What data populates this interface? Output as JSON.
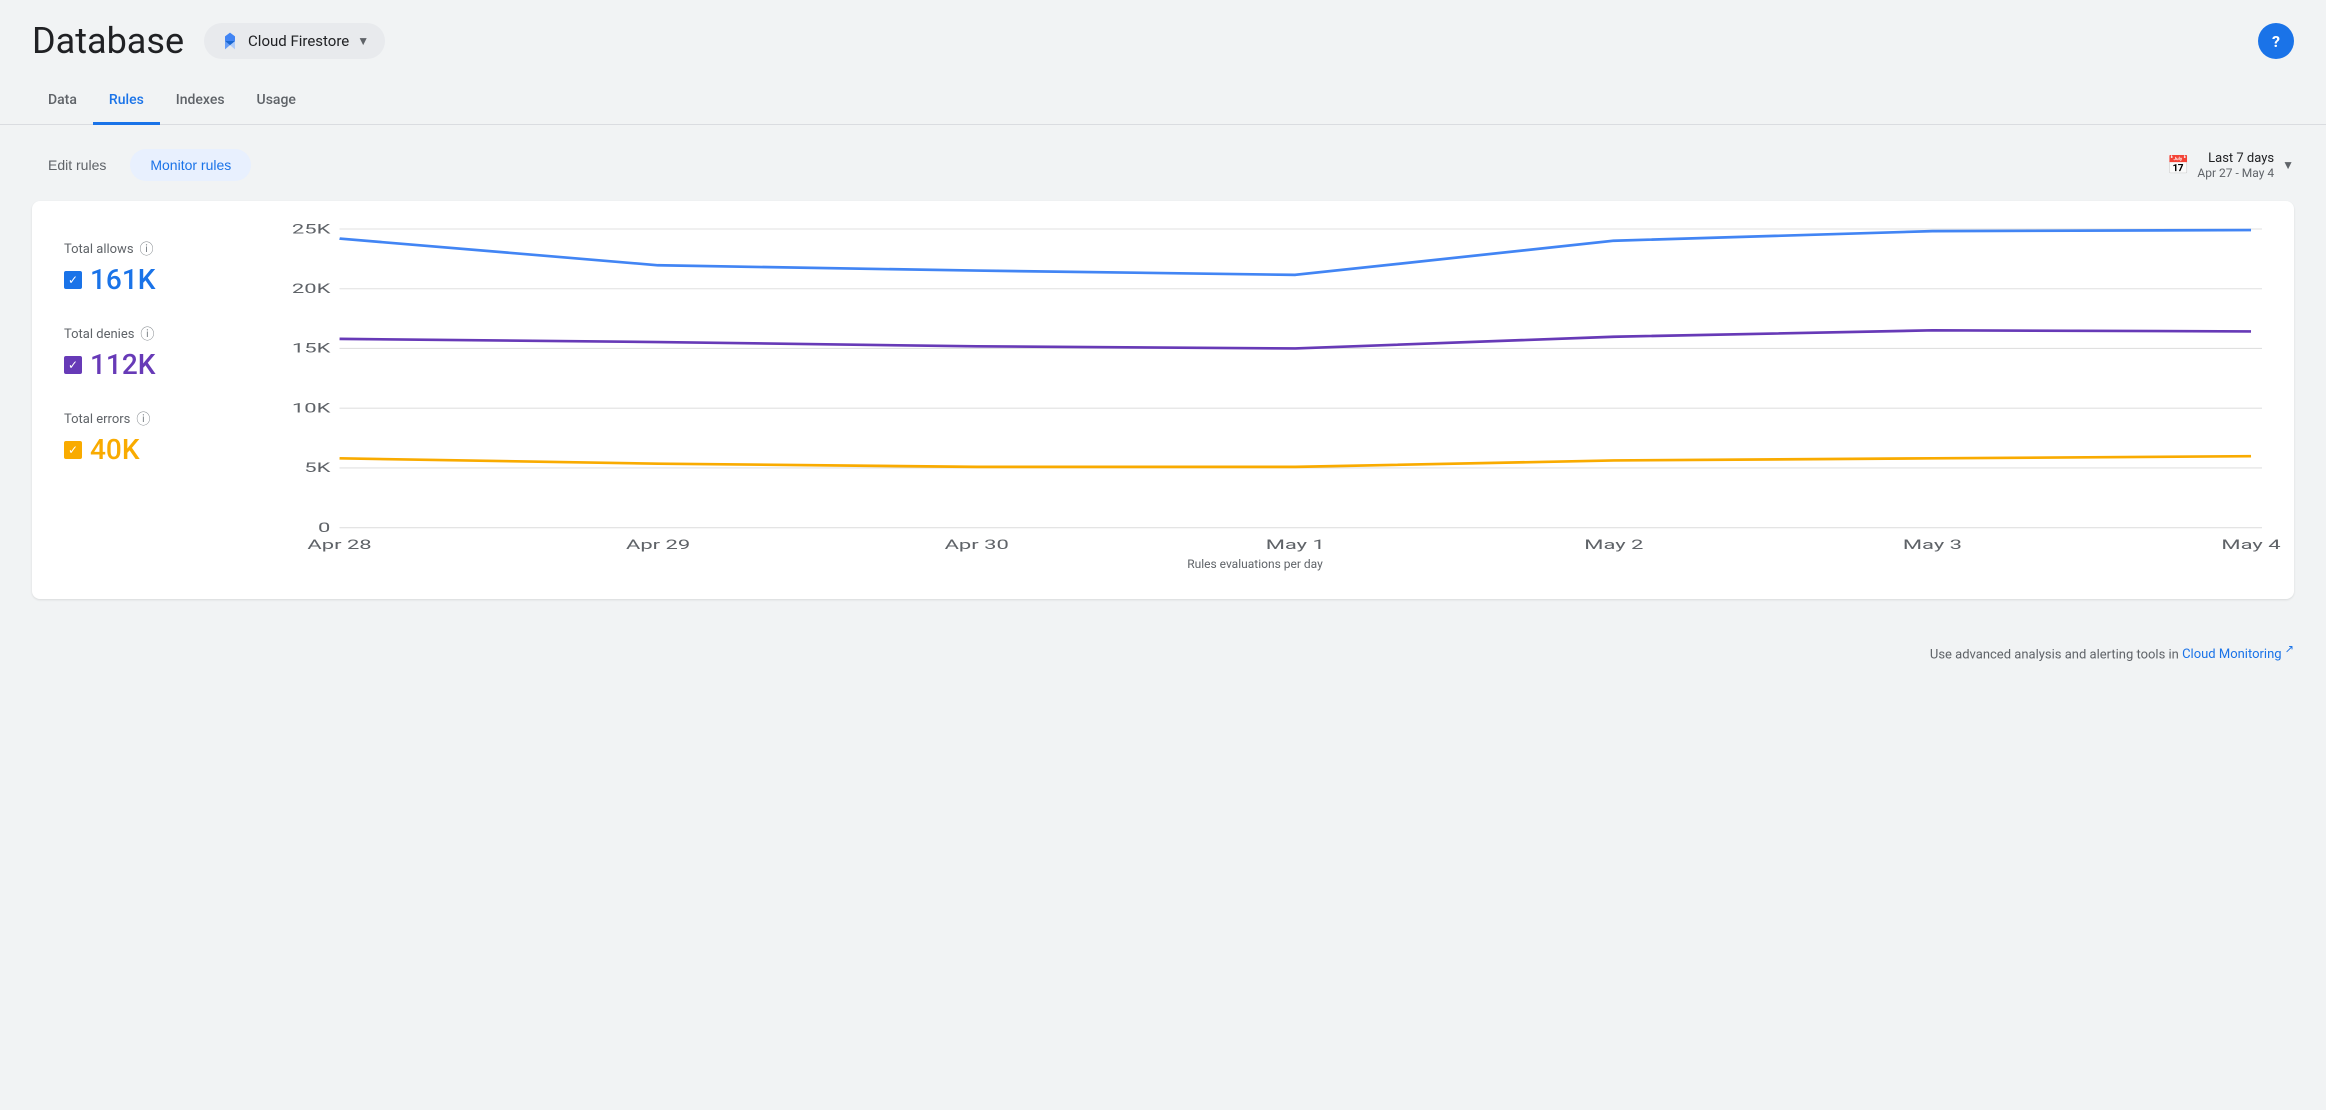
{
  "header": {
    "title": "Database",
    "service": {
      "name": "Cloud Firestore",
      "icon": "firestore-icon"
    },
    "help_label": "?"
  },
  "nav": {
    "tabs": [
      {
        "id": "data",
        "label": "Data",
        "active": false
      },
      {
        "id": "rules",
        "label": "Rules",
        "active": true
      },
      {
        "id": "indexes",
        "label": "Indexes",
        "active": false
      },
      {
        "id": "usage",
        "label": "Usage",
        "active": false
      }
    ]
  },
  "toolbar": {
    "edit_rules_label": "Edit rules",
    "monitor_rules_label": "Monitor rules"
  },
  "date_picker": {
    "icon": "📅",
    "label": "Last 7 days",
    "range": "Apr 27 - May 4"
  },
  "chart": {
    "title": "Rules evaluations per day",
    "y_labels": [
      "25K",
      "20K",
      "15K",
      "10K",
      "5K",
      "0"
    ],
    "x_labels": [
      "Apr 28",
      "Apr 29",
      "Apr 30",
      "May 1",
      "May 2",
      "May 3",
      "May 4"
    ],
    "series": [
      {
        "id": "allows",
        "label": "Total allows",
        "value": "161K",
        "color": "#4285f4",
        "checkbox_color": "blue",
        "data": [
          24200,
          22000,
          21500,
          21200,
          24000,
          24800,
          24900
        ]
      },
      {
        "id": "denies",
        "label": "Total denies",
        "value": "112K",
        "color": "#673ab7",
        "checkbox_color": "purple",
        "data": [
          15800,
          15500,
          15200,
          15000,
          16000,
          16500,
          16400
        ]
      },
      {
        "id": "errors",
        "label": "Total errors",
        "value": "40K",
        "color": "#f9ab00",
        "checkbox_color": "gold",
        "data": [
          5800,
          5400,
          5100,
          5100,
          5600,
          5800,
          6000
        ]
      }
    ]
  },
  "footer": {
    "note": "Use advanced analysis and alerting tools in",
    "link_text": "Cloud Monitoring",
    "link_icon": "↗"
  }
}
